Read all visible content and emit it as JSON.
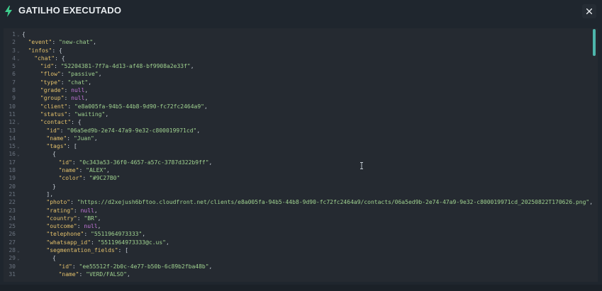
{
  "header": {
    "title": "GATILHO EXECUTADO",
    "icon": "lightning-bolt-icon",
    "close_icon": "close-icon",
    "accent": "#3ecf8e"
  },
  "editor": {
    "lines": [
      {
        "n": "1",
        "fold": true,
        "indent": 0,
        "parts": [
          [
            "p",
            "{"
          ]
        ]
      },
      {
        "n": "2",
        "fold": false,
        "indent": 1,
        "parts": [
          [
            "k",
            "\"event\""
          ],
          [
            "p",
            ": "
          ],
          [
            "s",
            "\"new-chat\""
          ],
          [
            "p",
            ","
          ]
        ]
      },
      {
        "n": "3",
        "fold": true,
        "indent": 1,
        "parts": [
          [
            "k",
            "\"infos\""
          ],
          [
            "p",
            ": {"
          ]
        ]
      },
      {
        "n": "4",
        "fold": true,
        "indent": 2,
        "parts": [
          [
            "k",
            "\"chat\""
          ],
          [
            "p",
            ": {"
          ]
        ]
      },
      {
        "n": "5",
        "fold": false,
        "indent": 3,
        "parts": [
          [
            "k",
            "\"id\""
          ],
          [
            "p",
            ": "
          ],
          [
            "s",
            "\"52204381-7f7a-4d13-af48-bf9908a2e33f\""
          ],
          [
            "p",
            ","
          ]
        ]
      },
      {
        "n": "6",
        "fold": false,
        "indent": 3,
        "parts": [
          [
            "k",
            "\"flow\""
          ],
          [
            "p",
            ": "
          ],
          [
            "s",
            "\"passive\""
          ],
          [
            "p",
            ","
          ]
        ]
      },
      {
        "n": "7",
        "fold": false,
        "indent": 3,
        "parts": [
          [
            "k",
            "\"type\""
          ],
          [
            "p",
            ": "
          ],
          [
            "s",
            "\"chat\""
          ],
          [
            "p",
            ","
          ]
        ]
      },
      {
        "n": "8",
        "fold": false,
        "indent": 3,
        "parts": [
          [
            "k",
            "\"grade\""
          ],
          [
            "p",
            ": "
          ],
          [
            "n",
            "null"
          ],
          [
            "p",
            ","
          ]
        ]
      },
      {
        "n": "9",
        "fold": false,
        "indent": 3,
        "parts": [
          [
            "k",
            "\"group\""
          ],
          [
            "p",
            ": "
          ],
          [
            "n",
            "null"
          ],
          [
            "p",
            ","
          ]
        ]
      },
      {
        "n": "10",
        "fold": false,
        "indent": 3,
        "parts": [
          [
            "k",
            "\"client\""
          ],
          [
            "p",
            ": "
          ],
          [
            "s",
            "\"e8a005fa-94b5-44b8-9d90-fc72fc2464a9\""
          ],
          [
            "p",
            ","
          ]
        ]
      },
      {
        "n": "11",
        "fold": false,
        "indent": 3,
        "parts": [
          [
            "k",
            "\"status\""
          ],
          [
            "p",
            ": "
          ],
          [
            "s",
            "\"waiting\""
          ],
          [
            "p",
            ","
          ]
        ]
      },
      {
        "n": "12",
        "fold": true,
        "indent": 3,
        "parts": [
          [
            "k",
            "\"contact\""
          ],
          [
            "p",
            ": {"
          ]
        ]
      },
      {
        "n": "13",
        "fold": false,
        "indent": 4,
        "parts": [
          [
            "k",
            "\"id\""
          ],
          [
            "p",
            ": "
          ],
          [
            "s",
            "\"06a5ed9b-2e74-47a9-9e32-c800019971cd\""
          ],
          [
            "p",
            ","
          ]
        ]
      },
      {
        "n": "14",
        "fold": false,
        "indent": 4,
        "parts": [
          [
            "k",
            "\"name\""
          ],
          [
            "p",
            ": "
          ],
          [
            "s",
            "\"Juan\""
          ],
          [
            "p",
            ","
          ]
        ]
      },
      {
        "n": "15",
        "fold": true,
        "indent": 4,
        "parts": [
          [
            "k",
            "\"tags\""
          ],
          [
            "p",
            ": ["
          ]
        ]
      },
      {
        "n": "16",
        "fold": true,
        "indent": 5,
        "parts": [
          [
            "p",
            "{"
          ]
        ]
      },
      {
        "n": "17",
        "fold": false,
        "indent": 6,
        "parts": [
          [
            "k",
            "\"id\""
          ],
          [
            "p",
            ": "
          ],
          [
            "s",
            "\"0c343a53-36f0-4657-a57c-3787d322b9ff\""
          ],
          [
            "p",
            ","
          ]
        ]
      },
      {
        "n": "18",
        "fold": false,
        "indent": 6,
        "parts": [
          [
            "k",
            "\"name\""
          ],
          [
            "p",
            ": "
          ],
          [
            "s",
            "\"ALEX\""
          ],
          [
            "p",
            ","
          ]
        ]
      },
      {
        "n": "19",
        "fold": false,
        "indent": 6,
        "parts": [
          [
            "k",
            "\"color\""
          ],
          [
            "p",
            ": "
          ],
          [
            "s",
            "\"#9C27B0\""
          ]
        ]
      },
      {
        "n": "20",
        "fold": false,
        "indent": 5,
        "parts": [
          [
            "p",
            "}"
          ]
        ]
      },
      {
        "n": "21",
        "fold": false,
        "indent": 4,
        "parts": [
          [
            "p",
            "],"
          ]
        ]
      },
      {
        "n": "22",
        "fold": false,
        "indent": 4,
        "parts": [
          [
            "k",
            "\"photo\""
          ],
          [
            "p",
            ": "
          ],
          [
            "s",
            "\"https://d2xejush6bftoo.cloudfront.net/clients/e8a005fa-94b5-44b8-9d90-fc72fc2464a9/contacts/06a5ed9b-2e74-47a9-9e32-c800019971cd_20250822T170626.png\""
          ],
          [
            "p",
            ","
          ]
        ]
      },
      {
        "n": "23",
        "fold": false,
        "indent": 4,
        "parts": [
          [
            "k",
            "\"rating\""
          ],
          [
            "p",
            ": "
          ],
          [
            "n",
            "null"
          ],
          [
            "p",
            ","
          ]
        ]
      },
      {
        "n": "24",
        "fold": false,
        "indent": 4,
        "parts": [
          [
            "k",
            "\"country\""
          ],
          [
            "p",
            ": "
          ],
          [
            "s",
            "\"BR\""
          ],
          [
            "p",
            ","
          ]
        ]
      },
      {
        "n": "25",
        "fold": false,
        "indent": 4,
        "parts": [
          [
            "k",
            "\"outcome\""
          ],
          [
            "p",
            ": "
          ],
          [
            "n",
            "null"
          ],
          [
            "p",
            ","
          ]
        ]
      },
      {
        "n": "26",
        "fold": false,
        "indent": 4,
        "parts": [
          [
            "k",
            "\"telephone\""
          ],
          [
            "p",
            ": "
          ],
          [
            "s",
            "\"5511964973333\""
          ],
          [
            "p",
            ","
          ]
        ]
      },
      {
        "n": "27",
        "fold": false,
        "indent": 4,
        "parts": [
          [
            "k",
            "\"whatsapp_id\""
          ],
          [
            "p",
            ": "
          ],
          [
            "s",
            "\"5511964973333@c.us\""
          ],
          [
            "p",
            ","
          ]
        ]
      },
      {
        "n": "28",
        "fold": true,
        "indent": 4,
        "parts": [
          [
            "k",
            "\"segmentation_fields\""
          ],
          [
            "p",
            ": ["
          ]
        ]
      },
      {
        "n": "29",
        "fold": true,
        "indent": 5,
        "parts": [
          [
            "p",
            "{"
          ]
        ]
      },
      {
        "n": "30",
        "fold": false,
        "indent": 6,
        "parts": [
          [
            "k",
            "\"id\""
          ],
          [
            "p",
            ": "
          ],
          [
            "s",
            "\"ee55512f-2b0c-4e77-b50b-6c89b2fba48b\""
          ],
          [
            "p",
            ","
          ]
        ]
      },
      {
        "n": "31",
        "fold": false,
        "indent": 6,
        "parts": [
          [
            "k",
            "\"name\""
          ],
          [
            "p",
            ": "
          ],
          [
            "s",
            "\"VERD/FALSO\""
          ],
          [
            "p",
            ","
          ]
        ]
      }
    ]
  }
}
